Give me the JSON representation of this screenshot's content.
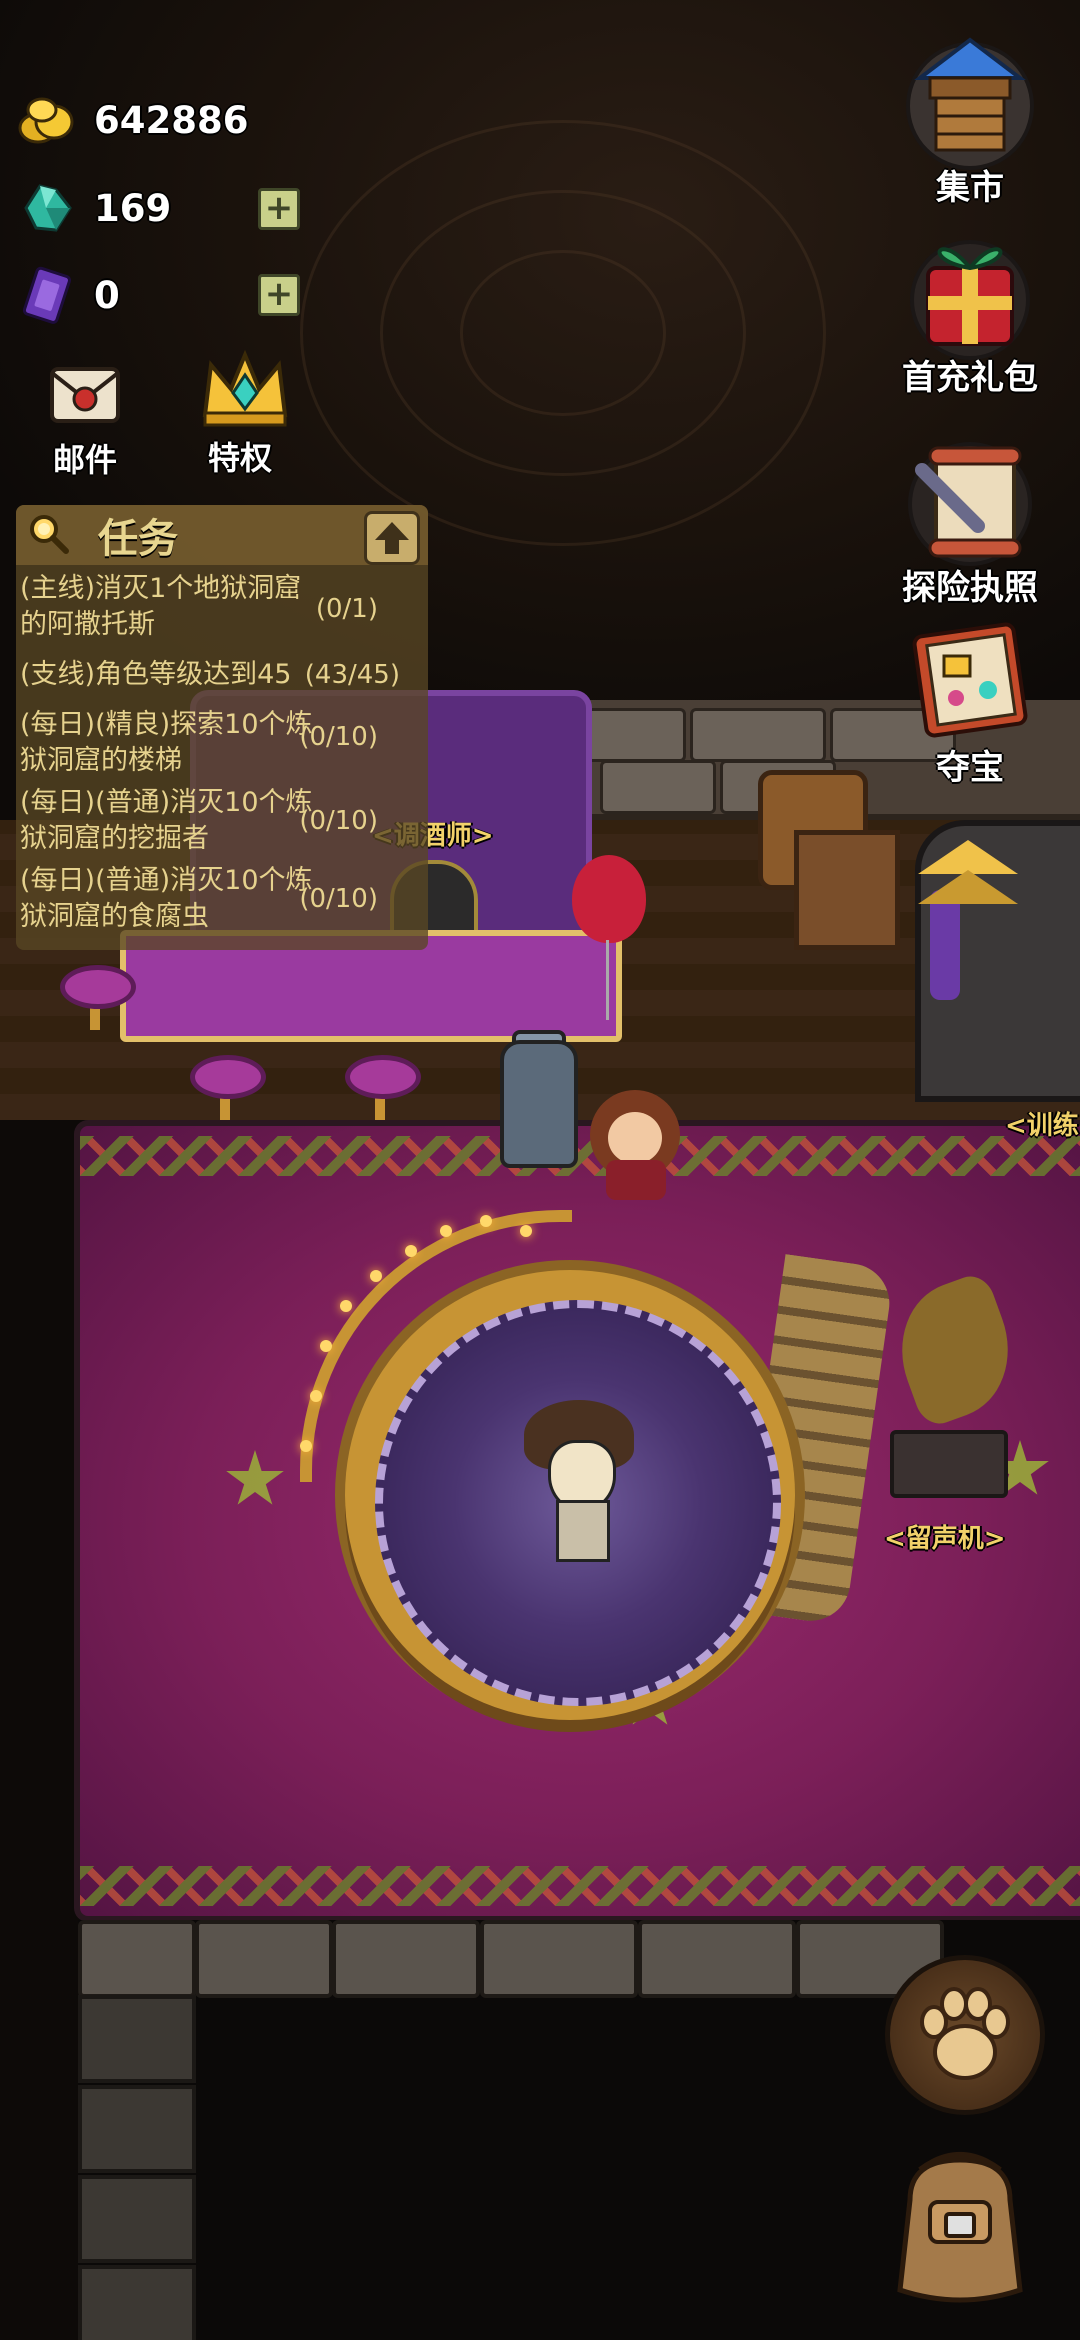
{
  "resources": {
    "gold": "642886",
    "gems": "169",
    "tickets": "0",
    "plus_symbol": "+"
  },
  "quick_actions": {
    "mail": "邮件",
    "privilege": "特权"
  },
  "right_menu": {
    "market": "集市",
    "first_charge": "首充礼包",
    "license": "探险执照",
    "treasure": "夺宝"
  },
  "quest": {
    "title": "任务",
    "items": [
      {
        "text_line1": "(主线)消灭1个地狱洞窟",
        "text_line2": "的阿撒托斯",
        "progress": "(0/1)"
      },
      {
        "text_line1": "(支线)角色等级达到45",
        "text_line2": "",
        "progress": "(43/45)"
      },
      {
        "text_line1": "(每日)(精良)探索10个炼",
        "text_line2": "狱洞窟的楼梯",
        "progress": "(0/10)"
      },
      {
        "text_line1": "(每日)(普通)消灭10个炼",
        "text_line2": "狱洞窟的挖掘者",
        "progress": "(0/10)"
      },
      {
        "text_line1": "(每日)(普通)消灭10个炼",
        "text_line2": "狱洞窟的食腐虫",
        "progress": "(0/10)"
      }
    ]
  },
  "npc_labels": {
    "bartender": "<调酒师>",
    "trainer": "<训练",
    "gramophone": "<留声机>"
  },
  "icons": {
    "gold": "gold-nugget-icon",
    "gem": "teal-gem-icon",
    "ticket": "purple-card-icon",
    "mail": "envelope-icon",
    "privilege": "crown-icon",
    "market": "market-stall-icon",
    "first_charge": "gift-box-icon",
    "license": "scroll-quill-icon",
    "treasure": "treasure-book-icon",
    "search": "magnifier-icon",
    "collapse": "arrow-up-icon",
    "paw": "paw-icon",
    "bag": "backpack-icon"
  },
  "colors": {
    "gold_text": "#f2d26a",
    "quest_text": "#e6d28e",
    "carpet": "#7b1f58"
  }
}
